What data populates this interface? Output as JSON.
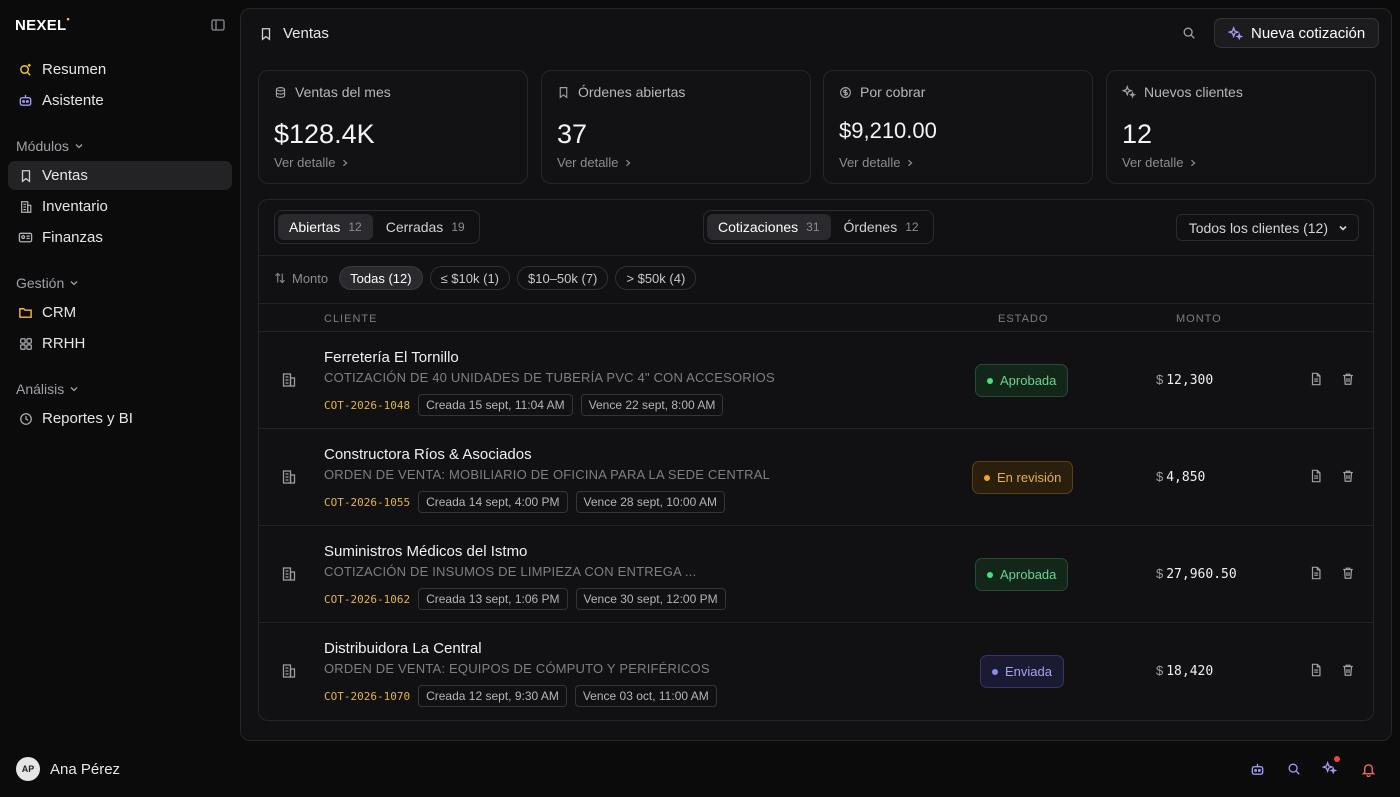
{
  "brand": "NEXEL",
  "brand_mark": "•",
  "sidebar": {
    "top_items": [
      {
        "label": "Resumen"
      },
      {
        "label": "Asistente"
      }
    ],
    "sections": [
      {
        "label": "Módulos",
        "items": [
          {
            "label": "Ventas"
          },
          {
            "label": "Inventario"
          },
          {
            "label": "Finanzas"
          }
        ]
      },
      {
        "label": "Gestión",
        "items": [
          {
            "label": "CRM"
          },
          {
            "label": "RRHH"
          }
        ]
      },
      {
        "label": "Análisis",
        "items": [
          {
            "label": "Reportes y BI"
          }
        ]
      }
    ],
    "active": "Ventas"
  },
  "user": {
    "initials": "AP",
    "name": "Ana Pérez"
  },
  "header": {
    "title": "Ventas",
    "new_button": "Nueva cotización"
  },
  "stats": [
    {
      "label": "Ventas del mes",
      "value": "$128.4K",
      "link": "Ver detalle"
    },
    {
      "label": "Órdenes abiertas",
      "value": "37",
      "link": "Ver detalle"
    },
    {
      "label": "Por cobrar",
      "value": "$9,210.00",
      "link": "Ver detalle"
    },
    {
      "label": "Nuevos clientes",
      "value": "12",
      "link": "Ver detalle"
    }
  ],
  "status_tabs": [
    {
      "label": "Abiertas",
      "count": "12",
      "active": true
    },
    {
      "label": "Cerradas",
      "count": "19",
      "active": false
    }
  ],
  "type_tabs": [
    {
      "label": "Cotizaciones",
      "count": "31",
      "active": true
    },
    {
      "label": "Órdenes",
      "count": "12",
      "active": false
    }
  ],
  "client_filter": {
    "selected": "Todos los clientes (12)"
  },
  "amount_filter": {
    "label": "Monto",
    "chips": [
      "Todas (12)",
      "≤ $10k (1)",
      "$10–50k (7)",
      "> $50k (4)"
    ],
    "active_index": 0
  },
  "table": {
    "headers": {
      "client": "CLIENTE",
      "status": "ESTADO",
      "amount": "MONTO"
    },
    "rows": [
      {
        "client": "Ferretería El Tornillo",
        "description": "COTIZACIÓN DE 40 UNIDADES DE TUBERÍA PVC 4\" CON ACCESORIOS",
        "code": "COT-2026-1048",
        "created": "Creada 15 sept, 11:04 AM",
        "due": "Vence 22 sept, 8:00 AM",
        "status": "Aprobada",
        "status_color": "#4ade80",
        "currency": "$",
        "amount": "12,300"
      },
      {
        "client": "Constructora Ríos & Asociados",
        "description": "ORDEN DE VENTA: MOBILIARIO DE OFICINA PARA LA SEDE CENTRAL",
        "code": "COT-2026-1055",
        "created": "Creada 14 sept, 4:00 PM",
        "due": "Vence 28 sept, 10:00 AM",
        "status": "En revisión",
        "status_color": "#f5a524",
        "currency": "$",
        "amount": "4,850"
      },
      {
        "client": "Suministros Médicos del Istmo",
        "description": "COTIZACIÓN DE INSUMOS DE LIMPIEZA CON ENTREGA ...",
        "code": "COT-2026-1062",
        "created": "Creada 13 sept, 1:06 PM",
        "due": "Vence 30 sept, 12:00 PM",
        "status": "Aprobada",
        "status_color": "#4ade80",
        "currency": "$",
        "amount": "27,960.50"
      },
      {
        "client": "Distribuidora La Central",
        "description": "ORDEN DE VENTA: EQUIPOS DE CÓMPUTO Y PERIFÉRICOS",
        "code": "COT-2026-1070",
        "created": "Creada 12 sept, 9:30 AM",
        "due": "Vence 03 oct, 11:00 AM",
        "status": "Enviada",
        "status_color": "#8b8bf5",
        "currency": "$",
        "amount": "18,420"
      }
    ]
  },
  "colors": {
    "accent": "#f5c542",
    "code": "#e0b44a",
    "notification": "#ef4444"
  }
}
